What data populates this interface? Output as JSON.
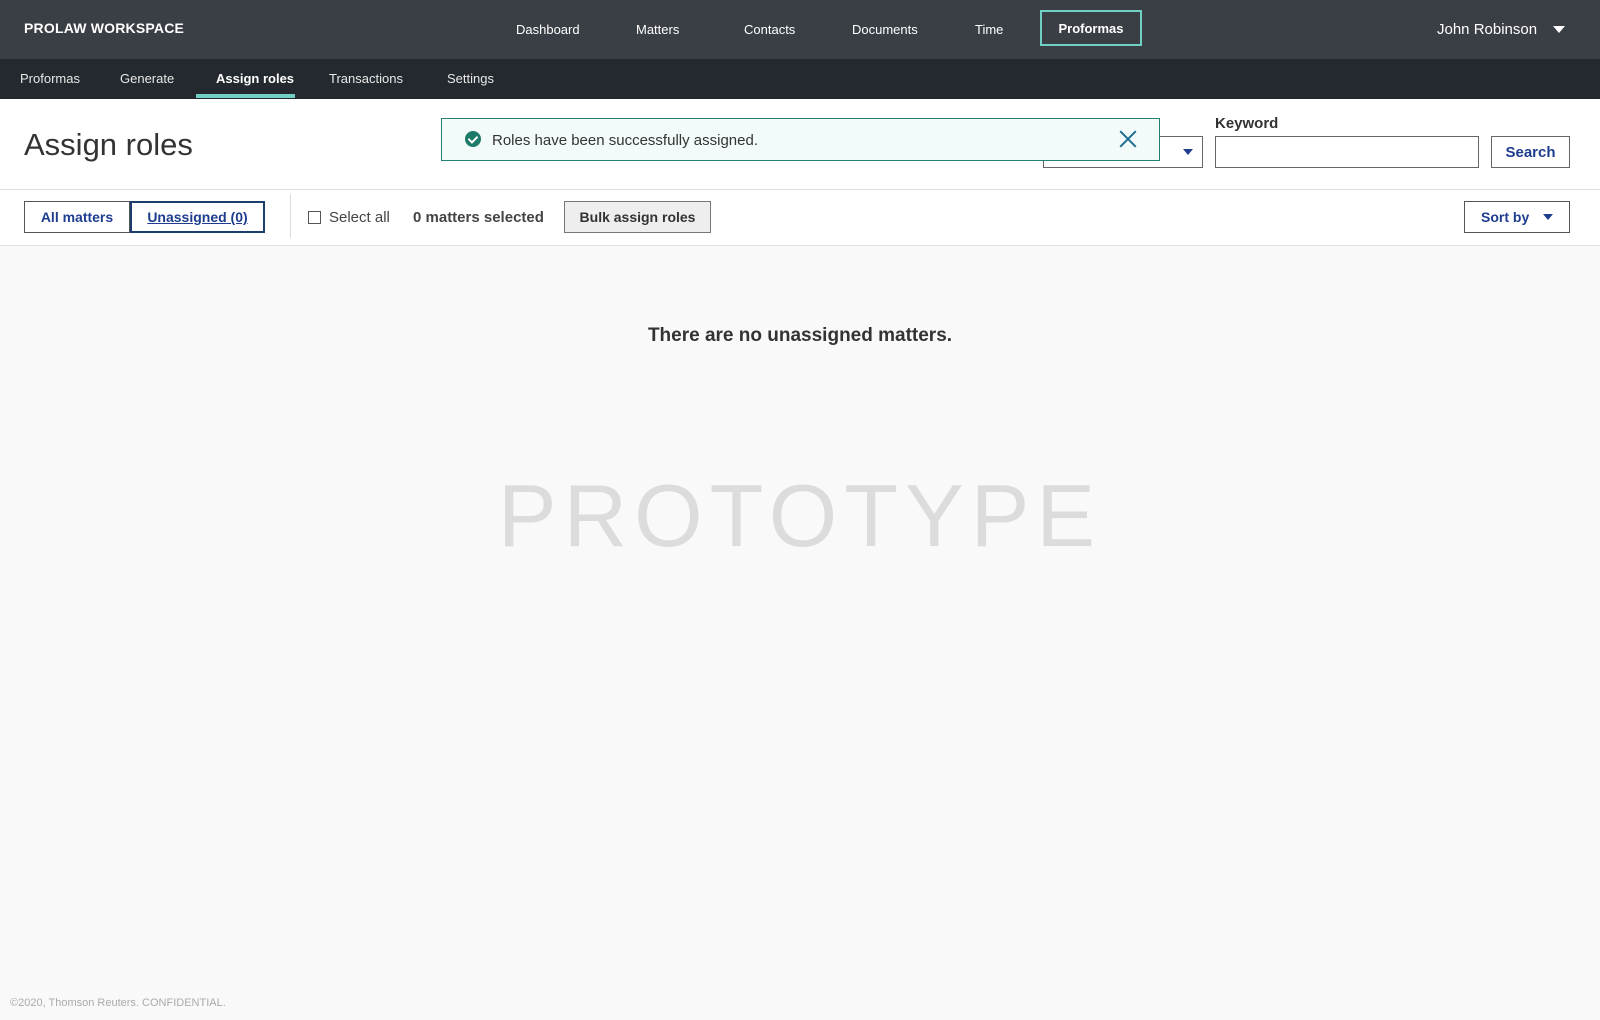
{
  "brand": "PROLAW WORKSPACE",
  "main_nav": {
    "dashboard": "Dashboard",
    "matters": "Matters",
    "contacts": "Contacts",
    "documents": "Documents",
    "time": "Time",
    "proformas": "Proformas"
  },
  "user": {
    "name": "John Robinson"
  },
  "sub_nav": {
    "proformas": "Proformas",
    "generate": "Generate",
    "assign_roles": "Assign roles",
    "transactions": "Transactions",
    "settings": "Settings"
  },
  "page": {
    "title": "Assign roles"
  },
  "toast": {
    "message": "Roles have been successfully assigned."
  },
  "filter": {
    "keyword_label": "Keyword",
    "keyword_value": "",
    "search_label": "Search"
  },
  "toolbar": {
    "tab_all": "All matters",
    "tab_unassigned": "Unassigned (0)",
    "select_all": "Select all",
    "selected_count": "0 matters selected",
    "bulk_assign": "Bulk assign roles",
    "sort_by": "Sort by"
  },
  "content": {
    "empty_message": "There are no unassigned matters.",
    "watermark": "PROTOTYPE"
  },
  "footer": {
    "copyright": "©2020, Thomson Reuters. CONFIDENTIAL."
  },
  "colors": {
    "topbar": "#3a3e45",
    "subnav": "#24282f",
    "accent": "#6fd1c4",
    "link": "#1e3d8f",
    "success": "#1e7a68"
  }
}
